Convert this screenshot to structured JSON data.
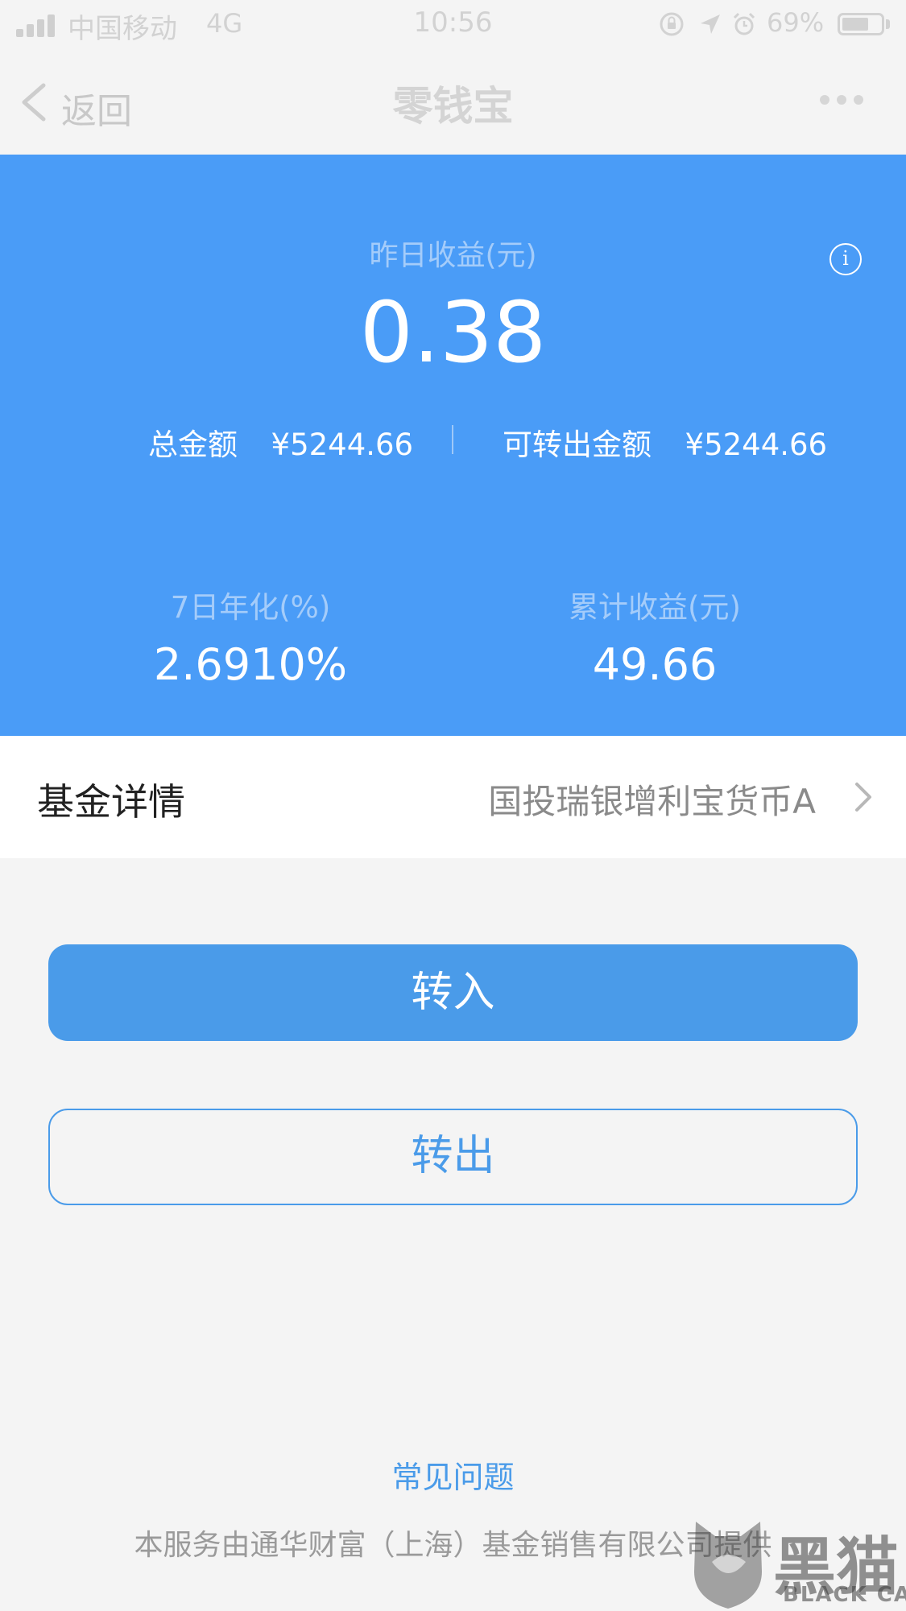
{
  "status_bar": {
    "carrier": "中国移动",
    "network": "4G",
    "time": "10:56",
    "battery_percent": "69%",
    "battery_level": 0.69,
    "icons": [
      "signal-icon",
      "lock-rotation-icon",
      "location-arrow-icon",
      "alarm-icon",
      "battery-icon"
    ]
  },
  "nav": {
    "back_label": "返回",
    "title": "零钱宝",
    "more_icon": "more-dots-icon"
  },
  "summary": {
    "yesterday_label": "昨日收益(元)",
    "yesterday_value": "0.38",
    "info_icon": "info-icon",
    "total_label": "总金额",
    "total_value": "¥5244.66",
    "transferable_label": "可转出金额",
    "transferable_value": "¥5244.66",
    "annual_label": "7日年化(%)",
    "annual_value": "2.6910%",
    "cumulative_label": "累计收益(元)",
    "cumulative_value": "49.66"
  },
  "fund": {
    "label": "基金详情",
    "name": "国投瑞银增利宝货币A"
  },
  "actions": {
    "transfer_in": "转入",
    "transfer_out": "转出"
  },
  "footer": {
    "faq": "常见问题",
    "provider": "本服务由通华财富（上海）基金销售有限公司提供"
  },
  "watermark": {
    "cn": "黑猫",
    "en": "BLACK CAT"
  },
  "colors": {
    "summary_bg": "#4a9cf7",
    "primary_button": "#4a9be9",
    "page_bg": "#f4f4f4"
  }
}
